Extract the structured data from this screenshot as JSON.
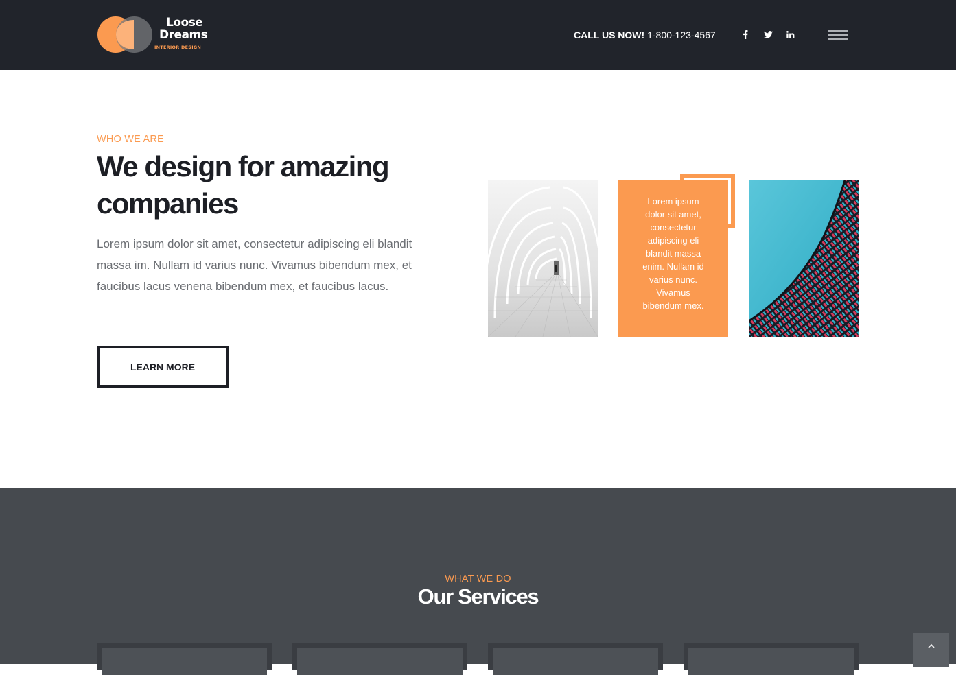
{
  "header": {
    "logo": {
      "line1": "Loose",
      "line2": "Dreams",
      "tagline": "INTERIOR DESIGN"
    },
    "call_label": "CALL US NOW!",
    "phone": "1-800-123-4567",
    "social": [
      {
        "name": "facebook",
        "glyph": "f"
      },
      {
        "name": "twitter",
        "glyph": ""
      },
      {
        "name": "linkedin",
        "glyph": "in"
      }
    ],
    "menu_icon": "hamburger-icon"
  },
  "about": {
    "eyebrow": "WHO WE ARE",
    "title": "We design for amazing companies",
    "body": "Lorem ipsum dolor sit amet, consectetur adipiscing eli blandit massa im. Nullam id varius nunc. Vivamus bibendum mex, et faucibus lacus venena bibendum mex, et faucibus lacus.",
    "button_label": "LEARN MORE",
    "card_text": "Lorem ipsum dolor sit amet, consectetur adipiscing eli blandit massa enim. Nullam id varius nunc. Vivamus bibendum mex."
  },
  "services": {
    "eyebrow": "WHAT WE DO",
    "title": "Our Services",
    "card_count_visible": 4
  },
  "colors": {
    "accent": "#fb9a50",
    "header_bg": "#21242b",
    "services_bg": "#464a4f",
    "heading": "#1d1f25"
  }
}
